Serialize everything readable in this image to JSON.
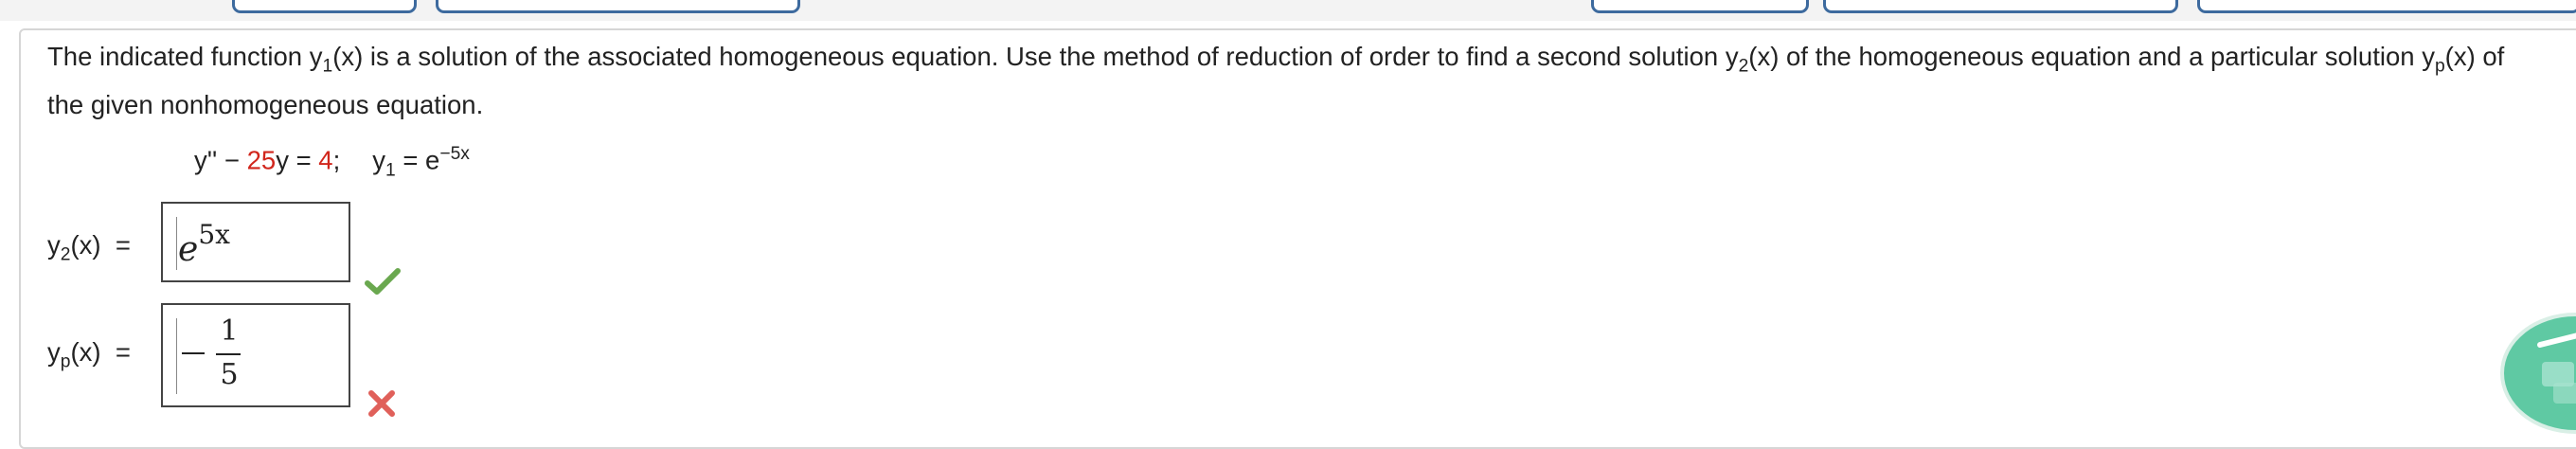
{
  "question": {
    "seg1": "The indicated function ",
    "y1_var": "y",
    "y1_sub": "1",
    "seg2": "(x) is a solution of the associated homogeneous equation. Use the method of reduction of order to find a second solution ",
    "y2_var": "y",
    "y2_sub": "2",
    "seg3": "(x) of the homogeneous equation and a particular solution ",
    "yp_var": "y",
    "yp_sub": "p",
    "seg4": "(x) of the given nonhomogeneous equation."
  },
  "equation": {
    "lhs": "y'' − ",
    "coef": "25",
    "var": "y",
    "eq": " = ",
    "rhs": "4",
    "semi": ";",
    "y1_var": "y",
    "y1_sub": "1",
    "y1_eq": " = ",
    "y1_base": "e",
    "y1_exp": "−5x"
  },
  "answers": {
    "y2": {
      "label_var": "y",
      "label_sub": "2",
      "label_rest": "(x)  =",
      "base": "e",
      "exp": "5x",
      "status": "correct"
    },
    "yp": {
      "label_var": "y",
      "label_sub": "p",
      "label_rest": "(x)  =",
      "sign": "−",
      "numerator": "1",
      "denominator": "5",
      "status": "incorrect"
    }
  },
  "colors": {
    "highlight": "#d1261c",
    "correct": "#6aa84f",
    "incorrect": "#e0605a",
    "tab_border": "#3d6a9e",
    "help_bubble": "#5fc9a3"
  },
  "icons": {
    "correct": "check-icon",
    "incorrect": "x-mark-icon",
    "help": "help-bubble-icon"
  }
}
